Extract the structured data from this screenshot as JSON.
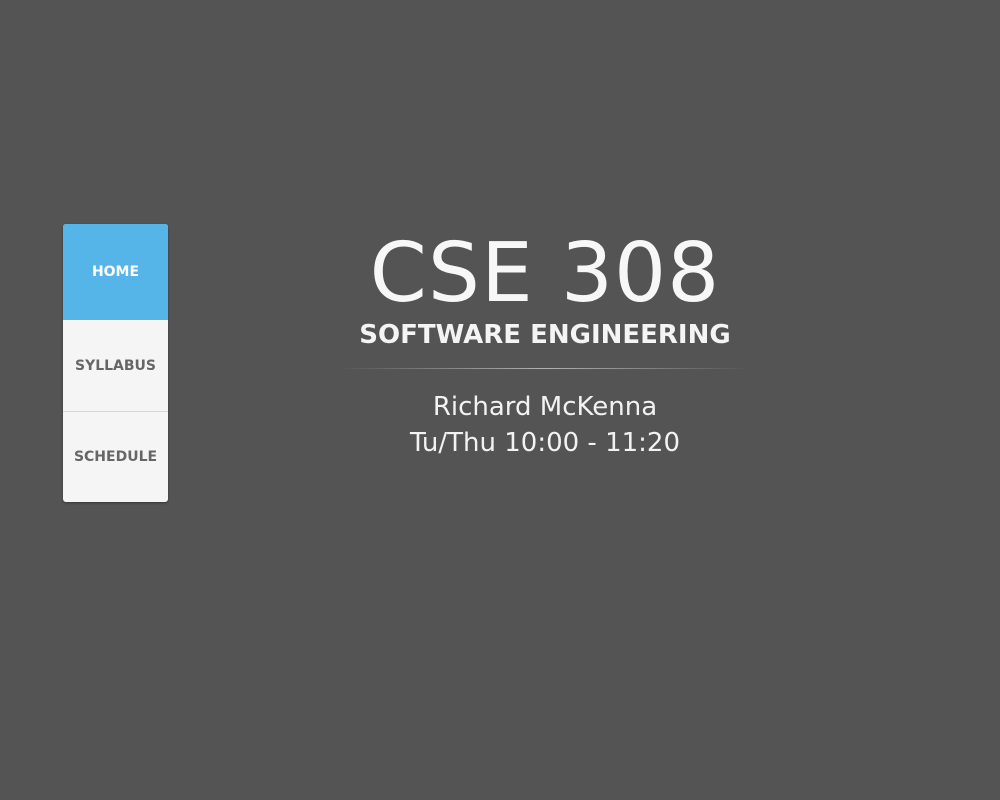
{
  "nav": {
    "items": [
      {
        "label": "HOME",
        "active": true
      },
      {
        "label": "SYLLABUS",
        "active": false
      },
      {
        "label": "SCHEDULE",
        "active": false
      }
    ]
  },
  "hero": {
    "course_code": "CSE 308",
    "course_name": "SOFTWARE ENGINEERING",
    "instructor": "Richard McKenna",
    "meeting_time": "Tu/Thu 10:00 - 11:20"
  },
  "colors": {
    "background": "#545454",
    "accent": "#56b5e8",
    "nav_background": "#f5f5f5"
  }
}
